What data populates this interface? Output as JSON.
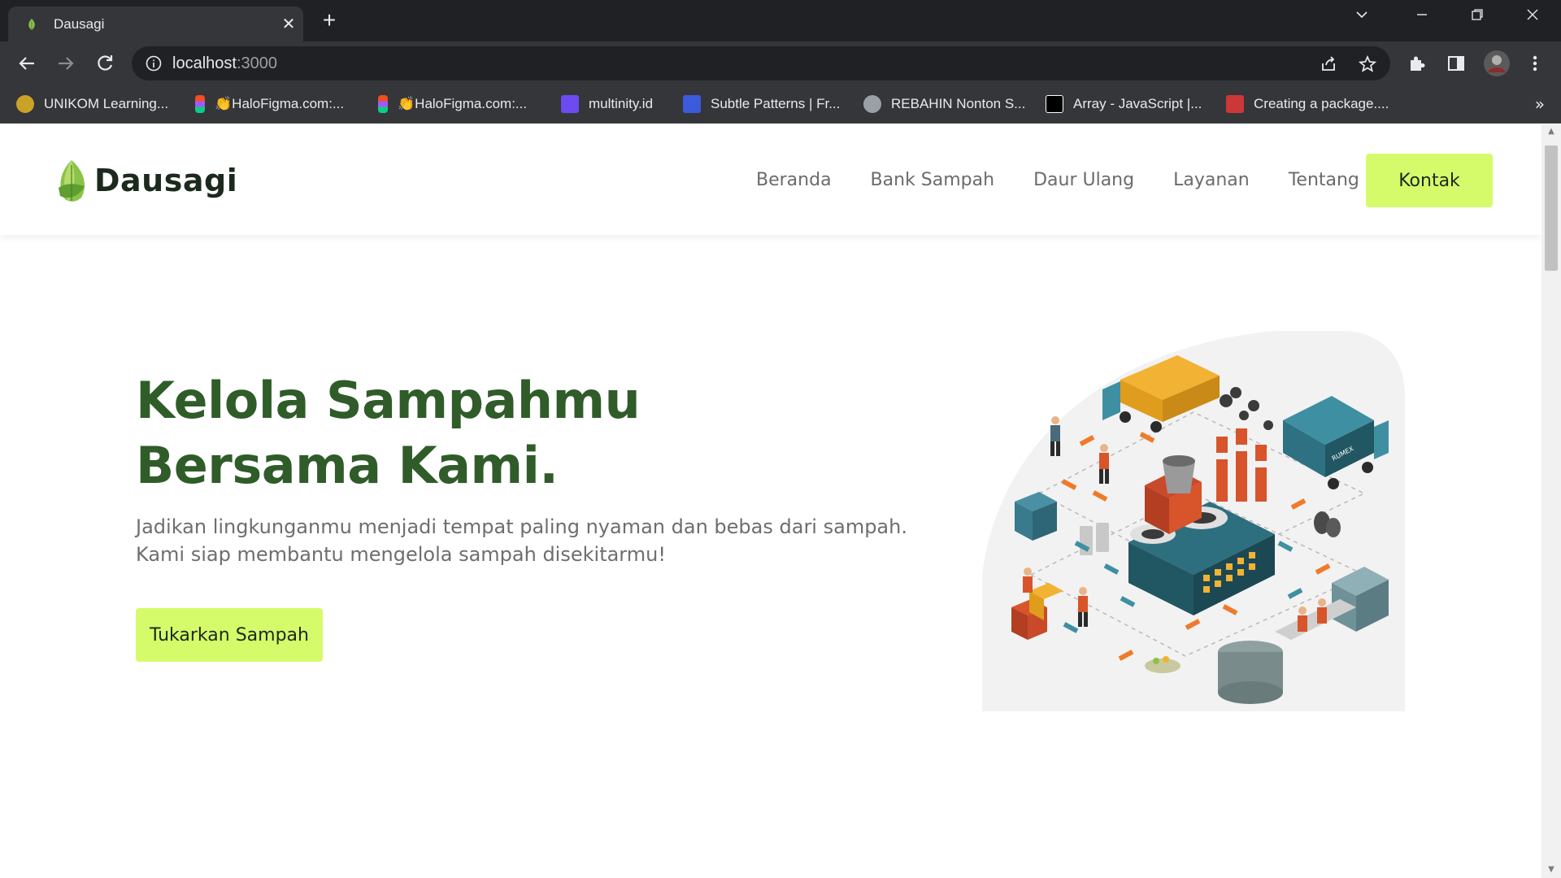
{
  "browser": {
    "tab_title": "Dausagi",
    "tab_close": "✕",
    "new_tab": "+",
    "url_host": "localhost",
    "url_port": ":3000",
    "bookmarks": [
      {
        "label": "UNIKOM Learning...",
        "icon": "unikom-icon",
        "color": "#c9a227"
      },
      {
        "label": "👏HaloFigma.com:...",
        "icon": "figma-icon",
        "color": "#f24e1e"
      },
      {
        "label": "👏HaloFigma.com:...",
        "icon": "figma-icon",
        "color": "#f24e1e"
      },
      {
        "label": "multinity.id",
        "icon": "multinity-icon",
        "color": "#6c4cf1"
      },
      {
        "label": "Subtle Patterns | Fr...",
        "icon": "subtle-patterns-icon",
        "color": "#3b5bdb"
      },
      {
        "label": "REBAHIN Nonton S...",
        "icon": "globe-icon",
        "color": "#9aa0a6"
      },
      {
        "label": "Array - JavaScript |...",
        "icon": "mdn-icon",
        "color": "#000000"
      },
      {
        "label": "Creating a package....",
        "icon": "npm-icon",
        "color": "#cb3837"
      }
    ],
    "bookmarks_overflow": "»"
  },
  "site": {
    "brand": "Dausagi",
    "nav": [
      "Beranda",
      "Bank Sampah",
      "Daur Ulang",
      "Layanan",
      "Tentang Kami"
    ],
    "contact_button": "Kontak",
    "accent_color": "#d6fb6a",
    "title_color": "#2f5c29"
  },
  "hero": {
    "title": "Kelola Sampahmu Bersama Kami.",
    "subtitle": "Jadikan lingkunganmu menjadi tempat paling nyaman dan bebas dari sampah. Kami siap membantu mengelola sampah disekitarmu!",
    "cta": "Tukarkan Sampah",
    "illustration": "waste-recycling-factory-illustration",
    "truck_label": "RUMEX"
  }
}
